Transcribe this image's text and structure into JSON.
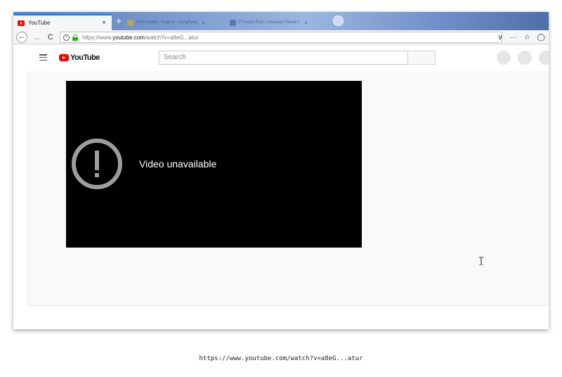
{
  "browser": {
    "active_tab": {
      "title": "YouTube",
      "close": "×",
      "favicon": "youtube-favicon-icon"
    },
    "new_tab": "+",
    "inactive_tabs": [
      {
        "title": "PDA model - Page 8 - LongRang",
        "close": "×",
        "favicon_color": "#f1b400"
      },
      {
        "title": "Forward Parts Lineaupe Resell c",
        "close": "×",
        "favicon_color": "#2b5797"
      }
    ],
    "nav": {
      "back": "←",
      "forward": "→",
      "reload": "C"
    },
    "url": {
      "prefix": "https://www.",
      "domain": "youtube.com",
      "path": "/watch?v=a8eG...atur"
    },
    "url_actions": {
      "dropdown": "∨",
      "more": "···",
      "bookmark": "☆",
      "shield": "◯"
    }
  },
  "youtube": {
    "logo_text": "YouTube",
    "search": {
      "placeholder": "Search"
    },
    "player": {
      "error_message": "Video unavailable"
    }
  },
  "caption": "https://www.youtube.com/watch?v=a8eG...atur",
  "colors": {
    "youtube_red": "#ff0000",
    "tab_highlight": "#0a84ff",
    "lock_green": "#12bc00",
    "error_gray": "#9e9e9e"
  }
}
